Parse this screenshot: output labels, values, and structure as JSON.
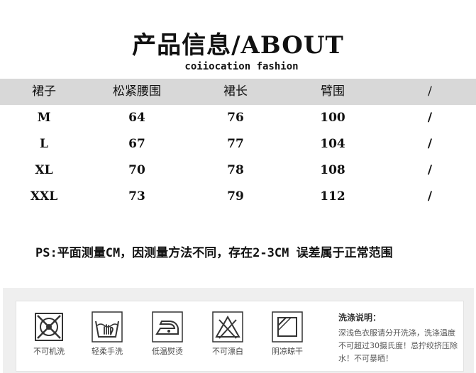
{
  "title": "产品信息/ABOUT",
  "subtitle": "coiiocation fashion",
  "table": {
    "headers": [
      "裙子",
      "松紧腰围",
      "裙长",
      "臂围",
      "/"
    ],
    "rows": [
      [
        "M",
        "64",
        "76",
        "100",
        "/"
      ],
      [
        "L",
        "67",
        "77",
        "104",
        "/"
      ],
      [
        "XL",
        "70",
        "78",
        "108",
        "/"
      ],
      [
        "XXL",
        "73",
        "79",
        "112",
        "/"
      ]
    ]
  },
  "note": "PS:平面测量CM，因测量方法不同，存在2-3CM 误差属于正常范围",
  "care": {
    "items": [
      {
        "label": "不可机洗",
        "icon": "no-machine-wash-icon"
      },
      {
        "label": "轻柔手洗",
        "icon": "hand-wash-icon"
      },
      {
        "label": "低温熨烫",
        "icon": "low-iron-icon"
      },
      {
        "label": "不可漂白",
        "icon": "no-bleach-icon"
      },
      {
        "label": "阴凉晾干",
        "icon": "shade-dry-icon"
      }
    ],
    "wash_title": "洗涤说明：",
    "wash_text": "深浅色衣服请分开洗涤，洗涤温度不可超过30摄氏度！忌拧绞挤压除水！不可暴晒！"
  },
  "colors": {
    "header_bg": "#d8d8d8",
    "care_bg": "#efefef"
  }
}
